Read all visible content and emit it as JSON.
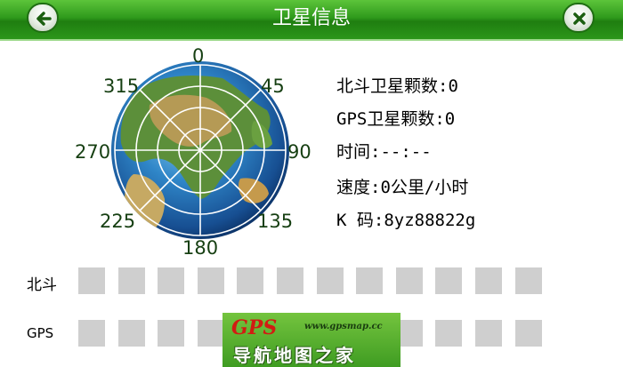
{
  "header": {
    "title": "卫星信息",
    "back_icon": "back-arrow-icon",
    "close_icon": "close-x-icon"
  },
  "globe": {
    "degrees": [
      "0",
      "45",
      "90",
      "135",
      "180",
      "225",
      "270",
      "315"
    ]
  },
  "info": {
    "beidou_count": "北斗卫星颗数:0",
    "gps_count": "GPS卫星颗数:0",
    "time": "时间:--:--",
    "speed": "速度:0公里/小时",
    "k_code": "K 码:8yz88822g"
  },
  "signals": {
    "beidou_label": "北斗",
    "gps_label": "GPS",
    "slots_per_row": 12
  },
  "watermark": {
    "brand": "GPS",
    "url": "www.gpsmap.cc",
    "name": "导航地图之家"
  },
  "colors": {
    "header_green": "#2f9a1c",
    "signal_empty": "#cfcfcf",
    "degree_text": "#163f12"
  }
}
